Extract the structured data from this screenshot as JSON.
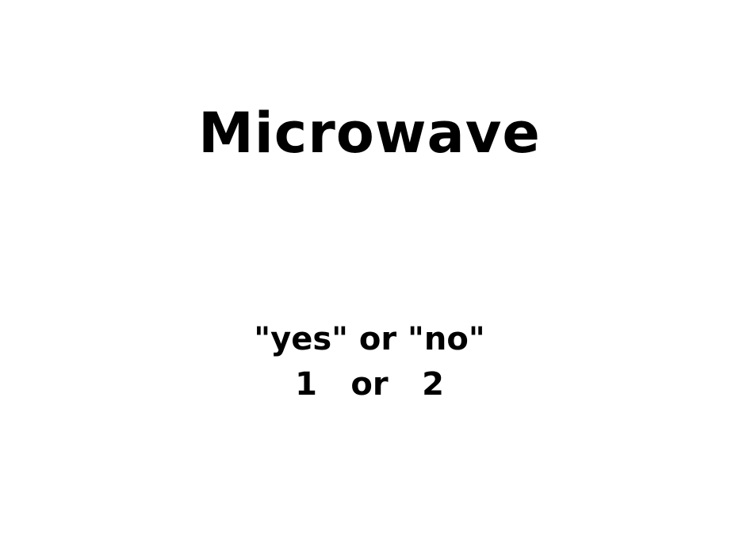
{
  "title": "Microwave",
  "options": {
    "line1": "\"yes\" or \"no\"",
    "line2": {
      "left": "1",
      "middle": "or",
      "right": "2"
    }
  }
}
